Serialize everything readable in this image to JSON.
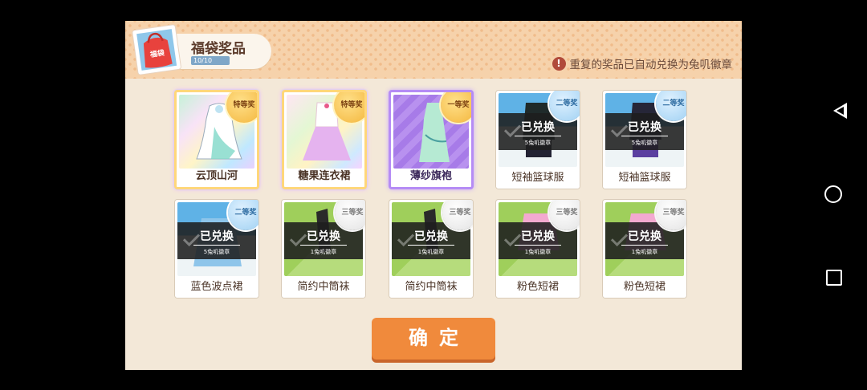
{
  "header": {
    "title": "福袋奖品",
    "progress_text": "10/10",
    "progress_fraction": 1.0,
    "bag_icon_text": "福袋",
    "notice_icon": "!",
    "notice_text": "重复的奖品已自动兑换为兔叽徽章"
  },
  "prizes": [
    {
      "name": "云顶山河",
      "tier": "特等奖",
      "tier_style": "gold",
      "redeemed": false
    },
    {
      "name": "糖果连衣裙",
      "tier": "特等奖",
      "tier_style": "gold",
      "redeemed": false
    },
    {
      "name": "薄纱旗袍",
      "tier": "一等奖",
      "tier_style": "gold",
      "redeemed": false
    },
    {
      "name": "短袖篮球服",
      "tier": "二等奖",
      "tier_style": "blue",
      "redeemed": true,
      "redeem_label": "已兑换",
      "redeem_detail": "5兔叽徽章"
    },
    {
      "name": "短袖篮球服",
      "tier": "二等奖",
      "tier_style": "blue",
      "redeemed": true,
      "redeem_label": "已兑换",
      "redeem_detail": "5兔叽徽章"
    },
    {
      "name": "蓝色波点裙",
      "tier": "二等奖",
      "tier_style": "blue",
      "redeemed": true,
      "redeem_label": "已兑换",
      "redeem_detail": "5兔叽徽章"
    },
    {
      "name": "简约中筒袜",
      "tier": "三等奖",
      "tier_style": "gray",
      "redeemed": true,
      "redeem_label": "已兑换",
      "redeem_detail": "1兔叽徽章"
    },
    {
      "name": "简约中筒袜",
      "tier": "三等奖",
      "tier_style": "gray",
      "redeemed": true,
      "redeem_label": "已兑换",
      "redeem_detail": "1兔叽徽章"
    },
    {
      "name": "粉色短裙",
      "tier": "三等奖",
      "tier_style": "gray",
      "redeemed": true,
      "redeem_label": "已兑换",
      "redeem_detail": "1兔叽徽章"
    },
    {
      "name": "粉色短裙",
      "tier": "三等奖",
      "tier_style": "gray",
      "redeemed": true,
      "redeem_label": "已兑换",
      "redeem_detail": "1兔叽徽章"
    }
  ],
  "confirm_label": "确定",
  "colors": {
    "accent": "#f08a3c",
    "panel": "#f3e8d8",
    "header": "#f6d2ab"
  }
}
